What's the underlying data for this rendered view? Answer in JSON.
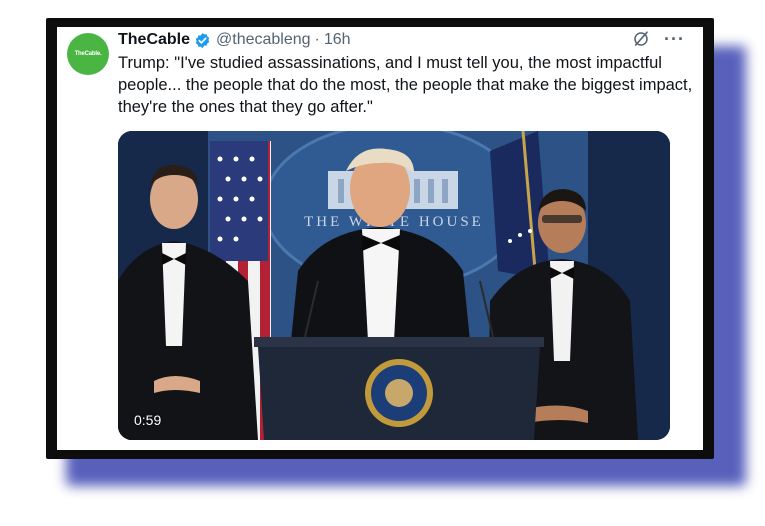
{
  "tweet": {
    "avatar_text": "TheCable.",
    "display_name": "TheCable",
    "handle": "@thecableng",
    "separator": "·",
    "time": "16h",
    "text": "Trump: \"I've studied assassinations, and I must tell you, the most impactful people... the people that do the most, the people that make the biggest impact, they're the ones that they go after.\"",
    "more_label": "···"
  },
  "media": {
    "type": "video",
    "duration": "0:59",
    "backdrop_text": "THE WHITE HOUSE"
  },
  "colors": {
    "verified": "#1d9bf0",
    "avatar": "#4bb543",
    "shadow": "#3a45b0",
    "frame": "#0d0d0d"
  },
  "icons": {
    "verified": "verified-badge-icon",
    "grok": "grok-icon",
    "more": "more-icon"
  }
}
